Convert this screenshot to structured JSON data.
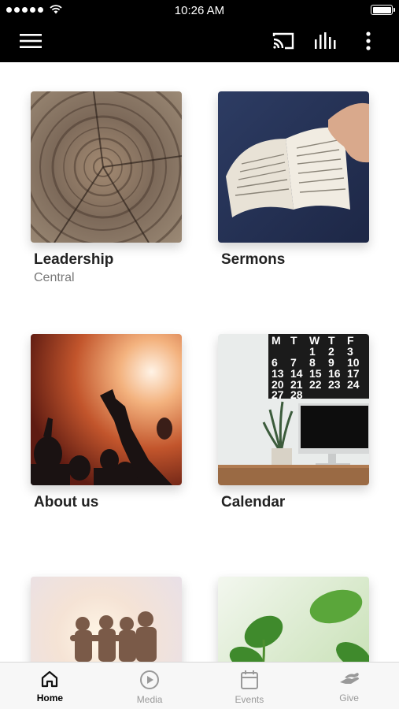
{
  "status_bar": {
    "time": "10:26 AM"
  },
  "app_bar": {
    "menu_icon": "hamburger-menu-icon",
    "cast_icon": "cast-icon",
    "bars_icon": "audio-bars-icon",
    "more_icon": "more-vertical-icon"
  },
  "tiles": [
    {
      "title": "Leadership",
      "subtitle": "Central",
      "image": "tree-rings-photo"
    },
    {
      "title": "Sermons",
      "subtitle": "",
      "image": "open-bible-photo"
    },
    {
      "title": "About us",
      "subtitle": "",
      "image": "worship-concert-photo"
    },
    {
      "title": "Calendar",
      "subtitle": "",
      "image": "desk-calendar-photo"
    },
    {
      "title": "",
      "subtitle": "",
      "image": "friends-sunset-photo"
    },
    {
      "title": "",
      "subtitle": "",
      "image": "green-plant-photo"
    }
  ],
  "tab_bar": {
    "tabs": [
      {
        "label": "Home",
        "icon": "home-icon",
        "active": true
      },
      {
        "label": "Media",
        "icon": "play-circle-icon",
        "active": false
      },
      {
        "label": "Events",
        "icon": "calendar-icon",
        "active": false
      },
      {
        "label": "Give",
        "icon": "giving-hand-icon",
        "active": false
      }
    ]
  },
  "colors": {
    "bar_background": "#000000",
    "active_tab": "#000000",
    "inactive_tab": "#999999"
  }
}
